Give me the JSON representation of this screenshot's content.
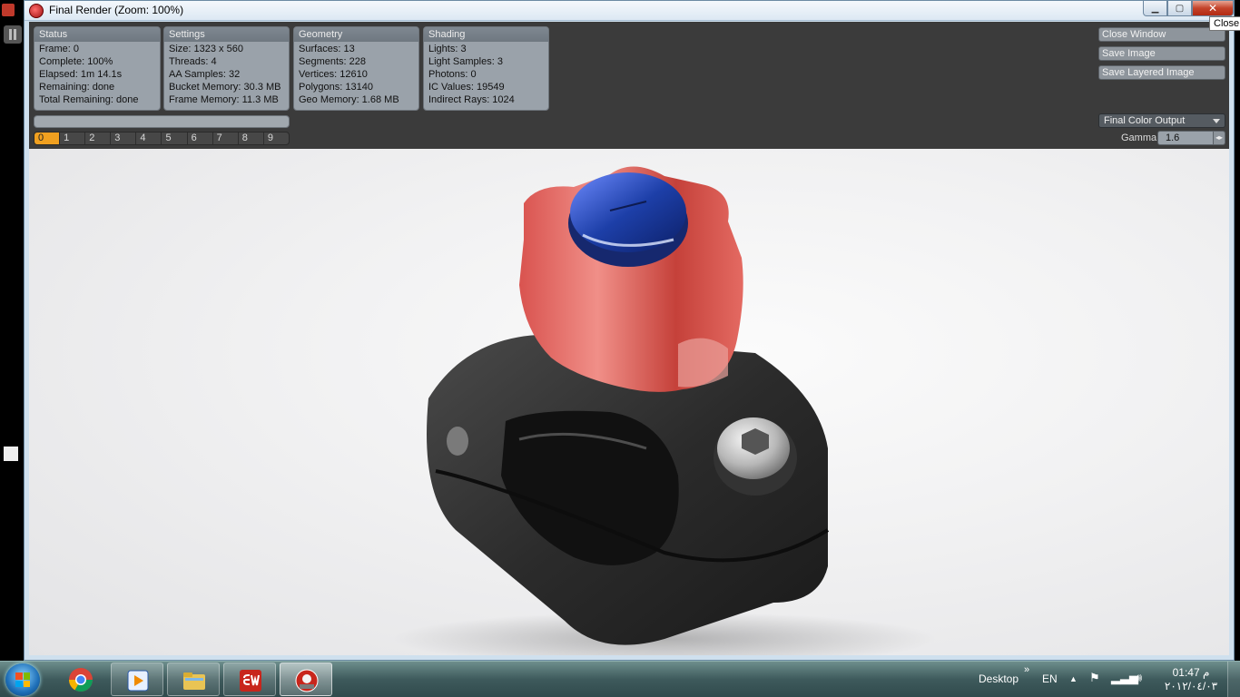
{
  "window": {
    "title": "Final Render (Zoom: 100%)",
    "tooltip": "Close",
    "buttons": {
      "minimize": "▁",
      "maximize": "▢",
      "close": "✕"
    }
  },
  "panels": {
    "status": {
      "header": "Status",
      "rows": [
        "Frame: 0",
        "Complete: 100%",
        "Elapsed: 1m 14.1s",
        "Remaining: done",
        "Total Remaining: done"
      ]
    },
    "settings": {
      "header": "Settings",
      "rows": [
        "Size: 1323 x 560",
        "Threads: 4",
        "AA Samples: 32",
        "Bucket Memory: 30.3 MB",
        "Frame Memory: 11.3 MB"
      ]
    },
    "geometry": {
      "header": "Geometry",
      "rows": [
        "Surfaces: 13",
        "Segments: 228",
        "Vertices: 12610",
        "Polygons: 13140",
        "Geo Memory: 1.68 MB"
      ]
    },
    "shading": {
      "header": "Shading",
      "rows": [
        "Lights: 3",
        "Light Samples: 3",
        "Photons: 0",
        "IC Values: 19549",
        "Indirect Rays: 1024"
      ]
    }
  },
  "frames": [
    "0",
    "1",
    "2",
    "3",
    "4",
    "5",
    "6",
    "7",
    "8",
    "9"
  ],
  "actions": {
    "close_window": "Close Window",
    "save_image": "Save Image",
    "save_layered": "Save Layered Image"
  },
  "output": {
    "dropdown": "Final Color Output",
    "gamma_label": "Gamma",
    "gamma_value": "1.6"
  },
  "taskbar": {
    "desktop_label": "Desktop",
    "language": "EN",
    "time": "01:47 م",
    "date": "٢٠١٢/٠٤/٠٣"
  },
  "colors": {
    "knob_red": "#c23a33",
    "cap_blue": "#1d3fa8",
    "clamp_black": "#2a2a2a",
    "frame_active": "#f0a020"
  }
}
